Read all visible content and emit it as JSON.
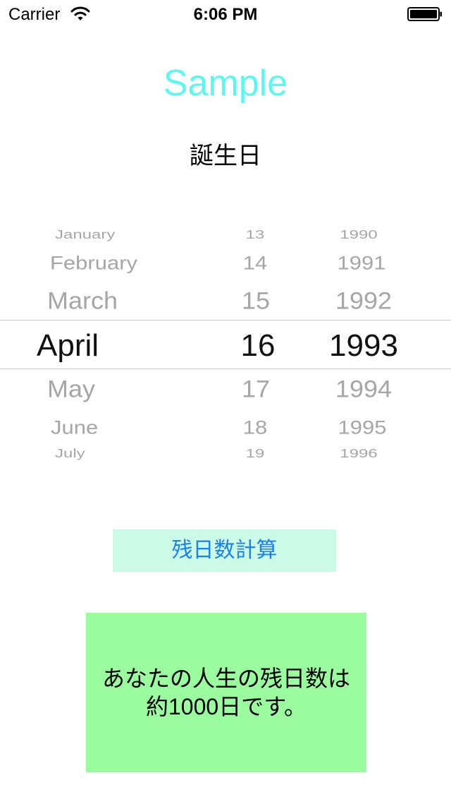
{
  "status_bar": {
    "carrier": "Carrier",
    "time": "6:06 PM",
    "wifi_icon": "wifi-icon",
    "battery_icon": "battery-full-icon"
  },
  "app": {
    "title": "Sample",
    "title_color": "#5ff5f0",
    "birthday_label": "誕生日"
  },
  "date_picker": {
    "month": {
      "items": [
        "January",
        "February",
        "March",
        "April",
        "May",
        "June",
        "July"
      ],
      "selected": "April"
    },
    "day": {
      "items": [
        "13",
        "14",
        "15",
        "16",
        "17",
        "18",
        "19"
      ],
      "selected": "16"
    },
    "year": {
      "items": [
        "1990",
        "1991",
        "1992",
        "1993",
        "1994",
        "1995",
        "1996"
      ],
      "selected": "1993"
    }
  },
  "calc_button": {
    "label": "残日数計算",
    "background": "#cbfae6",
    "text_color": "#1a7ef5"
  },
  "result": {
    "line1": "あなたの人生の残日数は",
    "line2": "約1000日です。",
    "background": "#9bfc9f"
  }
}
